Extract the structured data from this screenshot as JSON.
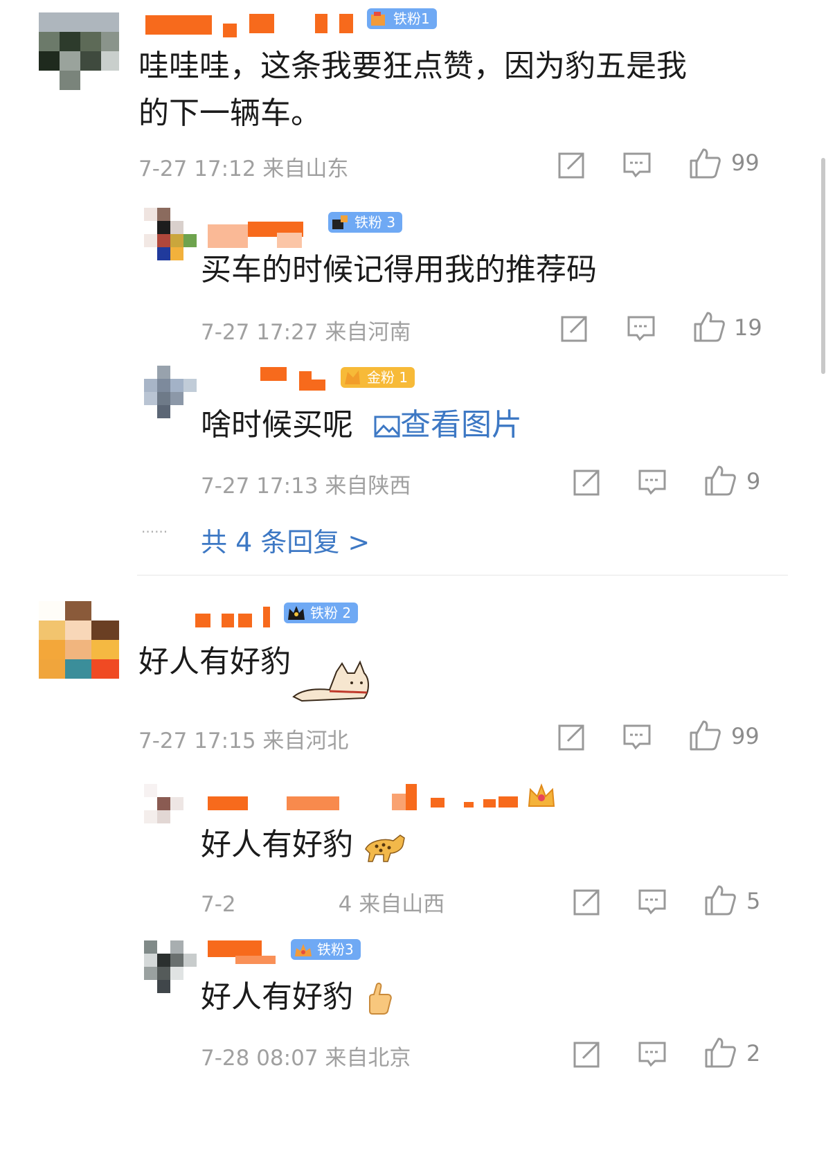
{
  "comments": [
    {
      "badge": "铁粉1",
      "text_line1": "哇哇哇，这条我要狂点赞，因为豹五是我",
      "text_line2": "的下一辆车。",
      "meta": "7-27 17:12 来自山东",
      "likes": "99",
      "replies": [
        {
          "badge": "铁粉 3",
          "text": "买车的时候记得用我的推荐码",
          "meta": "7-27 17:27 来自河南",
          "likes": "19"
        },
        {
          "badge": "金粉 1",
          "text": "啥时候买呢",
          "link": "查看图片",
          "meta": "7-27 17:13 来自陕西",
          "likes": "9"
        }
      ],
      "more_replies": "共 4 条回复 >",
      "more_dots": "······"
    },
    {
      "badge": "铁粉 2",
      "text": "好人有好豹",
      "meta": "7-27 17:15 来自河北",
      "likes": "99",
      "replies": [
        {
          "text": "好人有好豹",
          "meta_visible": "7-2",
          "meta_tail": "4 来自山西",
          "likes": "5"
        },
        {
          "badge": "铁粉3",
          "text": "好人有好豹",
          "meta": "7-28 08:07 来自北京",
          "likes": "2"
        }
      ]
    }
  ],
  "icons": {
    "repost": "repost-icon",
    "comment": "comment-icon",
    "like": "thumbs-up-icon",
    "image": "image-icon",
    "emoji_dog": "dog-sticker",
    "emoji_leopard": "leopard-emoji",
    "emoji_thumb": "thumbs-up-emoji"
  },
  "colors": {
    "link": "#3d78c4",
    "meta": "#a0a0a0",
    "badge_iron": "#6fa9f4",
    "badge_gold": "#f7ba38",
    "redact": "#f76a1c"
  }
}
